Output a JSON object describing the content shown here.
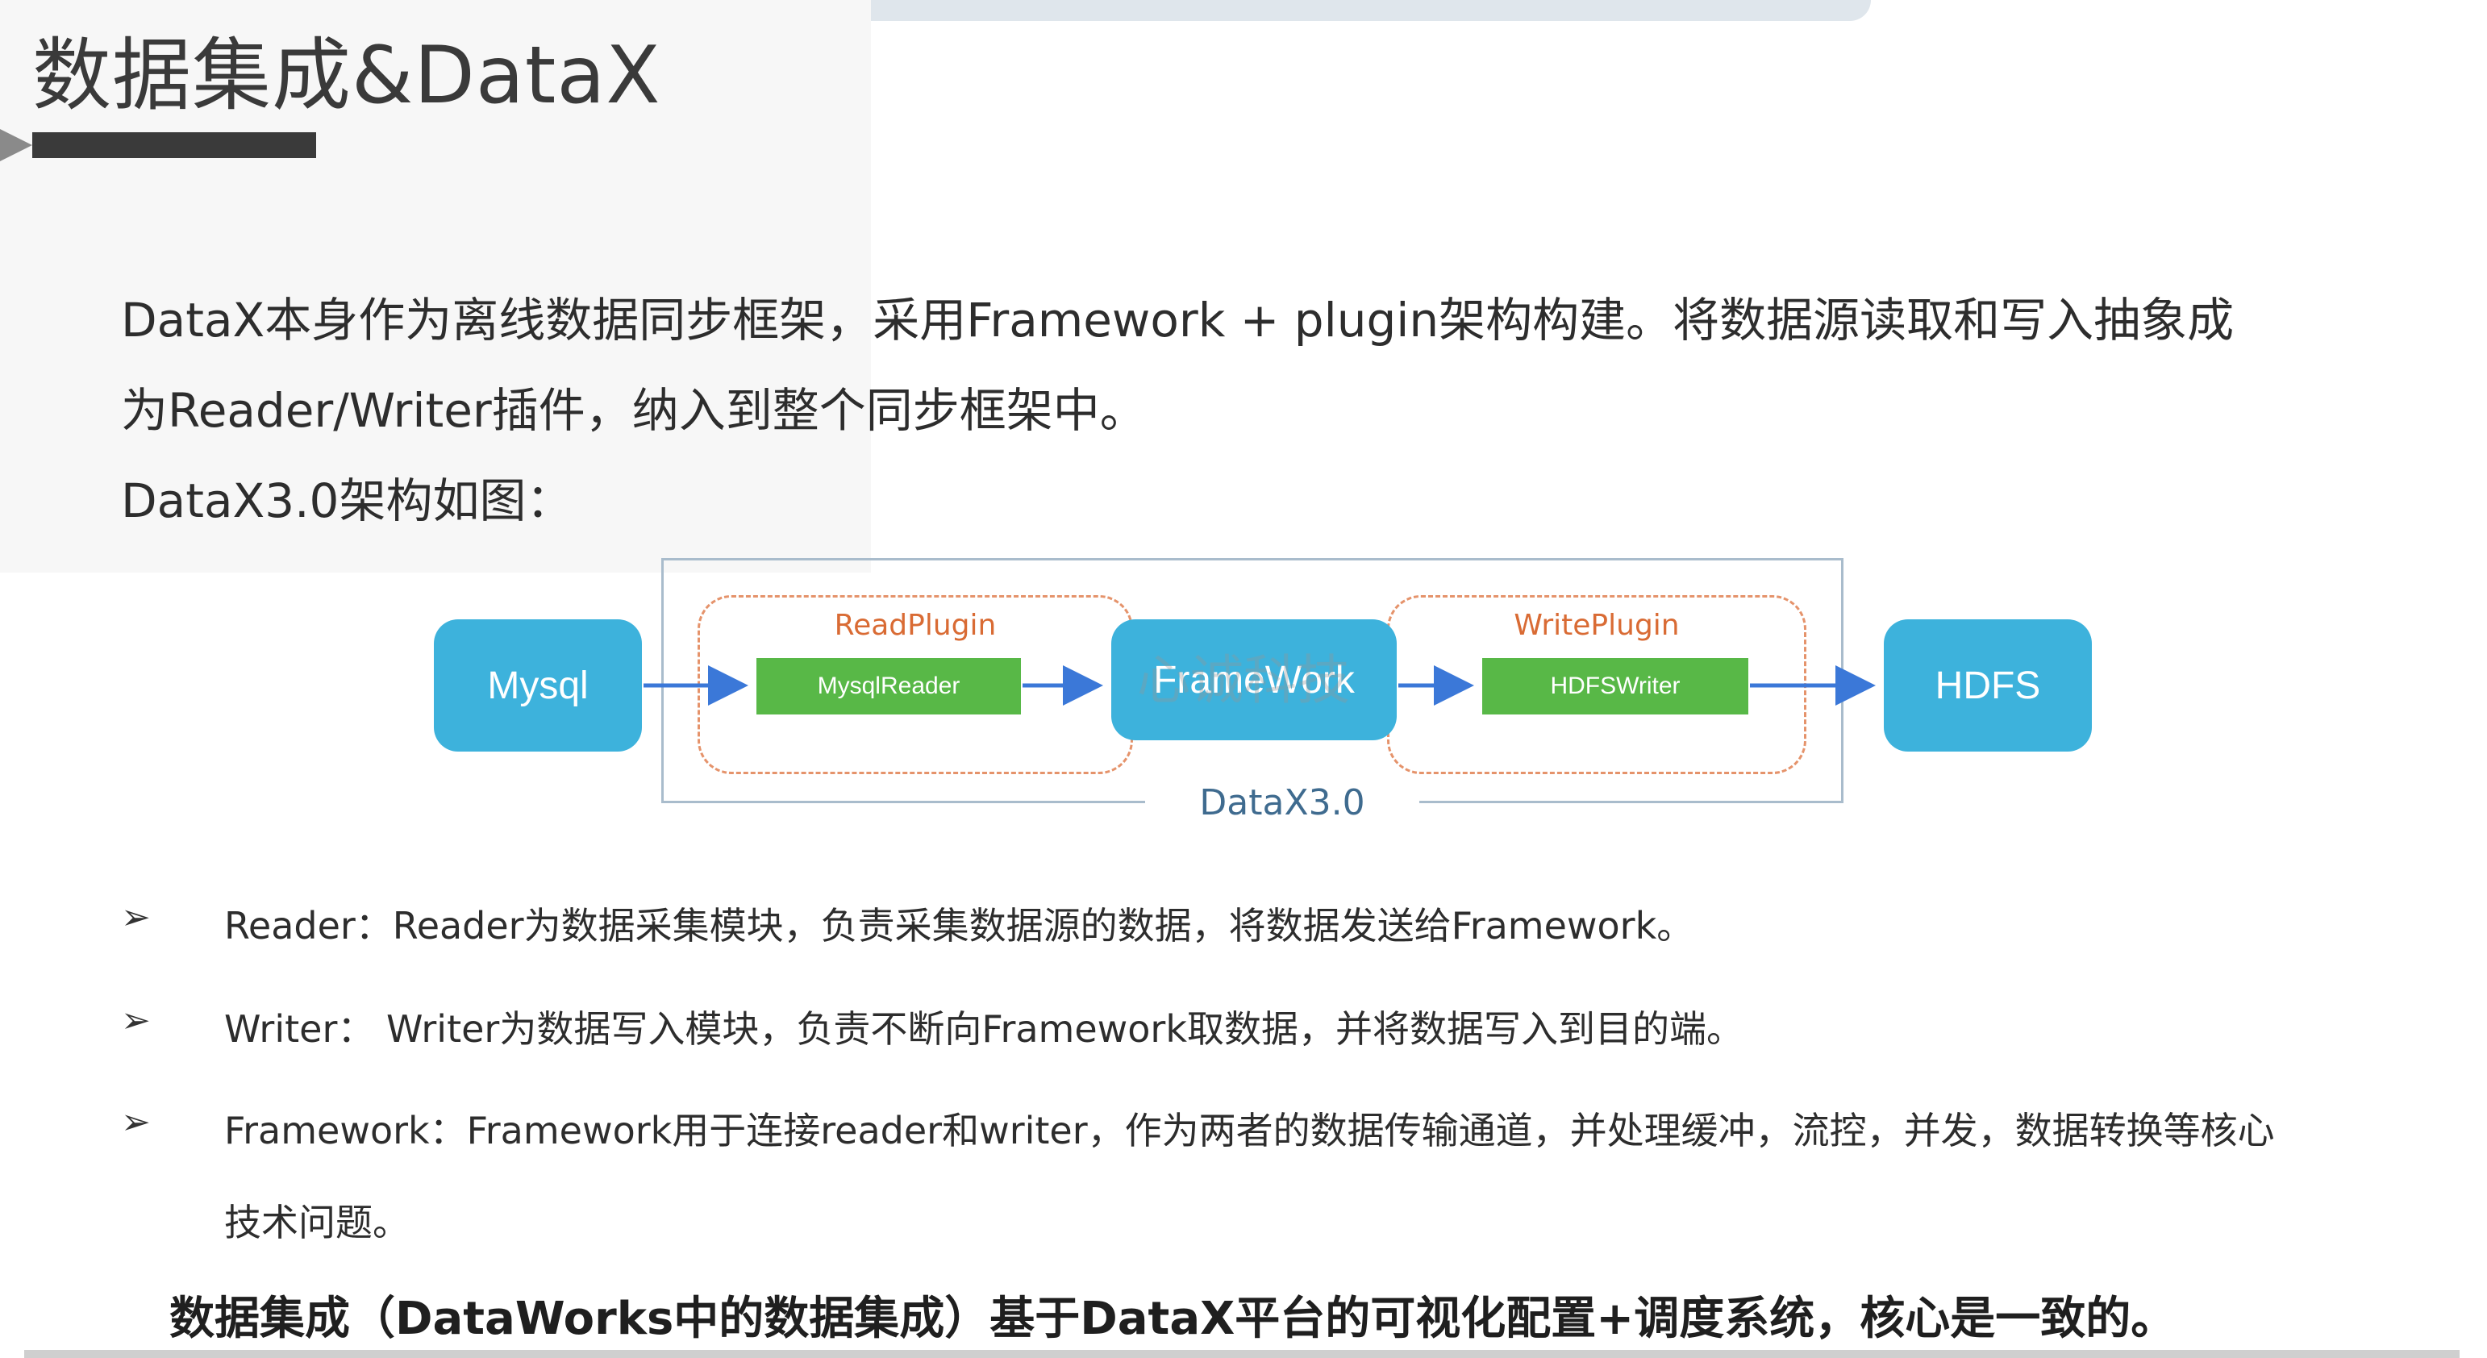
{
  "title": "数据集成&DataX",
  "intro": {
    "line1": "DataX本身作为离线数据同步框架，采用Framework + plugin架构构建。将数据源读取和写入抽象成",
    "line2": "为Reader/Writer插件，纳入到整个同步框架中。",
    "line3": "DataX3.0架构如图："
  },
  "diagram": {
    "source": "Mysql",
    "read_plugin_label": "ReadPlugin",
    "reader": "MysqlReader",
    "framework": "FrameWork",
    "write_plugin_label": "WritePlugin",
    "writer": "HDFSWriter",
    "target": "HDFS",
    "container_label": "DataX3.0",
    "watermark": "心诚科技",
    "colors": {
      "node": "#3db2dc",
      "plugin": "#58b847",
      "dashed_border": "#e5936b",
      "arrow": "#3b78d8",
      "frame_border": "#a9bccc"
    }
  },
  "bullets": {
    "marker": "➢",
    "reader": "Reader：Reader为数据采集模块，负责采集数据源的数据，将数据发送给Framework。",
    "writer": "Writer：  Writer为数据写入模块，负责不断向Framework取数据，并将数据写入到目的端。",
    "framework_line1": "Framework：Framework用于连接reader和writer，作为两者的数据传输通道，并处理缓冲，流控，并发，数据转换等核心",
    "framework_line2": "技术问题。"
  },
  "conclusion": "数据集成（DataWorks中的数据集成）基于DataX平台的可视化配置+调度系统，核心是一致的。"
}
